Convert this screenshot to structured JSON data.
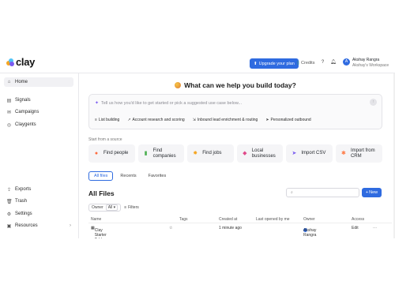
{
  "app": {
    "logo_text": "clay",
    "upgrade_label": "Upgrade your plan",
    "credits_label": "Credits",
    "user": {
      "initial": "A",
      "name": "Akshay Rangra",
      "workspace": "Akshay's Workspace"
    },
    "brand_color": "#2f6be0"
  },
  "sidebar": {
    "top_items": [
      {
        "label": "Home",
        "icon": "home-icon",
        "active": true
      },
      {
        "label": "Signals",
        "icon": "signals-icon"
      },
      {
        "label": "Campaigns",
        "icon": "campaigns-icon"
      },
      {
        "label": "Claygents",
        "icon": "claygents-icon"
      }
    ],
    "bottom_items": [
      {
        "label": "Exports",
        "icon": "exports-icon"
      },
      {
        "label": "Trash",
        "icon": "trash-icon"
      },
      {
        "label": "Settings",
        "icon": "settings-icon"
      },
      {
        "label": "Resources",
        "icon": "resources-icon"
      }
    ]
  },
  "main": {
    "heading": "What can we help you build today?",
    "prompt_placeholder": "Tell us how you'd like to get started or pick a suggested use case below...",
    "suggestions": [
      "List building",
      "Account research and scoring",
      "Inbound lead enrichment & routing",
      "Personalized outbound"
    ],
    "source_title": "Start from a source",
    "sources": [
      {
        "label": "Find people",
        "icon": "people-icon",
        "color": "#ff6b3d"
      },
      {
        "label": "Find companies",
        "icon": "companies-icon",
        "color": "#4caf50"
      },
      {
        "label": "Find jobs",
        "icon": "jobs-icon",
        "color": "#f5a623"
      },
      {
        "label": "Local businesses",
        "icon": "map-pin-icon",
        "color": "#e04a8a"
      },
      {
        "label": "Import CSV",
        "icon": "import-icon",
        "color": "#7a5cf0"
      },
      {
        "label": "Import from CRM",
        "icon": "crm-icon",
        "color": "#ff7a45"
      }
    ],
    "tabs": [
      "All files",
      "Recents",
      "Favorites"
    ],
    "active_tab": "All files",
    "page_title": "All Files",
    "new_label": "New",
    "filters": {
      "owner_label": "Owner",
      "owner_value": "All",
      "filters_label": "Filters"
    },
    "table": {
      "headers": [
        "Name",
        "Tags",
        "Created at",
        "Last opened by me",
        "Owner",
        "Access"
      ],
      "rows": [
        {
          "name": "Clay Starter Table",
          "created": "1 minute ago",
          "owner": "Akshay Rangra",
          "access": "Edit"
        }
      ]
    }
  }
}
